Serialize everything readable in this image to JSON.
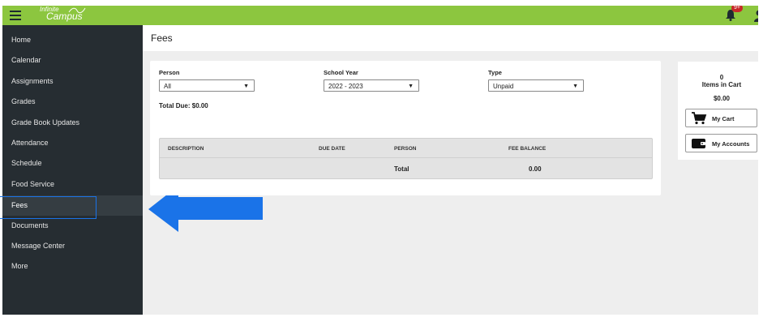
{
  "app": {
    "logo_line1": "Infinite",
    "logo_line2": "Campus",
    "notification_badge": "9+"
  },
  "sidebar": {
    "items": [
      {
        "label": "Home"
      },
      {
        "label": "Calendar"
      },
      {
        "label": "Assignments"
      },
      {
        "label": "Grades"
      },
      {
        "label": "Grade Book Updates"
      },
      {
        "label": "Attendance"
      },
      {
        "label": "Schedule"
      },
      {
        "label": "Food Service"
      },
      {
        "label": "Fees"
      },
      {
        "label": "Documents"
      },
      {
        "label": "Message Center"
      },
      {
        "label": "More"
      }
    ],
    "active": "Fees"
  },
  "page": {
    "title": "Fees"
  },
  "filters": {
    "person": {
      "label": "Person",
      "value": "All"
    },
    "school_year": {
      "label": "School Year",
      "value": "2022 - 2023"
    },
    "type": {
      "label": "Type",
      "value": "Unpaid"
    }
  },
  "total_due": "Total Due: $0.00",
  "table": {
    "headers": [
      "DESCRIPTION",
      "DUE DATE",
      "PERSON",
      "FEE BALANCE"
    ],
    "total_label": "Total",
    "total_value": "0.00"
  },
  "cart": {
    "count": "0",
    "label": "Items in Cart",
    "amount": "$0.00",
    "my_cart": "My Cart",
    "my_accounts": "My Accounts"
  },
  "colors": {
    "topbar": "#8cc63f",
    "sidebar": "#262d32",
    "arrow": "#1a73e8"
  }
}
